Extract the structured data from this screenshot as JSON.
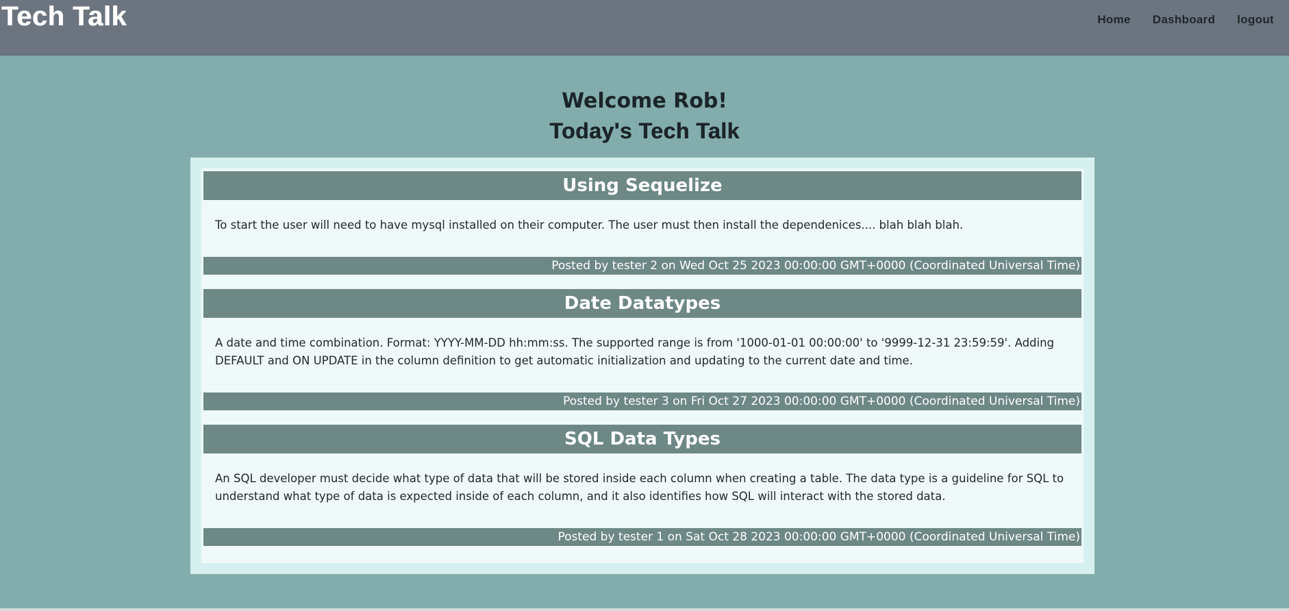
{
  "header": {
    "brand": "Tech Talk",
    "nav": {
      "home": "Home",
      "dashboard": "Dashboard",
      "logout": "logout"
    }
  },
  "main": {
    "welcome": "Welcome Rob!",
    "subtitle": "Today's Tech Talk",
    "posts": [
      {
        "title": "Using Sequelize",
        "body": "To start the user will need to have mysql installed on their computer. The user must then install the dependenices.... blah blah blah.",
        "meta": "Posted by tester 2 on Wed Oct 25 2023 00:00:00 GMT+0000 (Coordinated Universal Time)"
      },
      {
        "title": "Date Datatypes",
        "body": "A date and time combination. Format: YYYY-MM-DD hh:mm:ss. The supported range is from '1000-01-01 00:00:00' to '9999-12-31 23:59:59'. Adding DEFAULT and ON UPDATE in the column definition to get automatic initialization and updating to the current date and time.",
        "meta": "Posted by tester 3 on Fri Oct 27 2023 00:00:00 GMT+0000 (Coordinated Universal Time)"
      },
      {
        "title": "SQL Data Types",
        "body": "An SQL developer must decide what type of data that will be stored inside each column when creating a table. The data type is a guideline for SQL to understand what type of data is expected inside of each column, and it also identifies how SQL will interact with the stored data.",
        "meta": "Posted by tester 1 on Sat Oct 28 2023 00:00:00 GMT+0000 (Coordinated Universal Time)"
      }
    ]
  },
  "colors": {
    "page_background": "#83adac",
    "header_background": "#6c7480",
    "post_bar": "#6d8885",
    "feed_frame": "#d6f0f0",
    "feed_panel": "#eff9f8"
  }
}
